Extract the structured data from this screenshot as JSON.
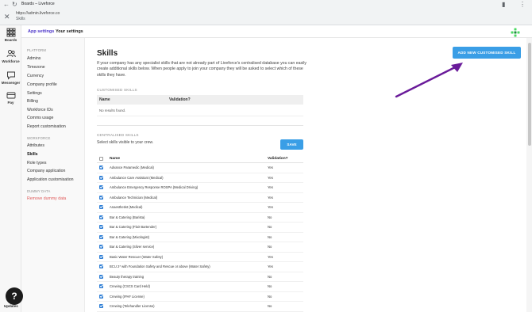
{
  "browser": {
    "tab_title": "Boards – Liveforce",
    "url": "https://admin.liveforce.co",
    "page_label": "Skills",
    "icons": [
      "back-icon",
      "reload-icon",
      "close-icon",
      "puzzle-icon",
      "menu-icon"
    ]
  },
  "left_nav": {
    "items": [
      {
        "label": "Boards",
        "icon": "grid-icon"
      },
      {
        "label": "Workforce",
        "icon": "people-icon"
      },
      {
        "label": "Messenger",
        "icon": "chat-icon"
      },
      {
        "label": "Pay",
        "icon": "pay-icon"
      }
    ]
  },
  "app_header": {
    "tabs": [
      "App settings",
      "Your settings"
    ],
    "accent": "#4c35c9",
    "logo_color": "#4cd964"
  },
  "sidebar": {
    "platform_heading": "PLATFORM",
    "platform_items": [
      "Admins",
      "Timezone",
      "Currency",
      "Company profile",
      "Settings",
      "Billing",
      "Workforce IDs",
      "Comms usage",
      "Report customisation"
    ],
    "workforce_heading": "WORKFORCE",
    "workforce_items": [
      "Attributes",
      "Skills",
      "Role types",
      "Company application",
      "Application customisation"
    ],
    "active_item": "Skills",
    "dummy_heading": "DUMMY DATA",
    "dummy_item": "Remove dummy data"
  },
  "main": {
    "title": "Skills",
    "intro": "If your company has any specialist skills that are not already part of Liveforce's centralised database you can easily create additional skills below. When people apply to join your company they will be asked to select which of these skills they have.",
    "add_button": "ADD NEW CUSTOMISED SKILL",
    "customised_label": "CUSTOMISED SKILLS",
    "customised_columns": [
      "Name",
      "Validation?"
    ],
    "customised_empty": "No results found.",
    "centralised_label": "CENTRALISED SKILLS",
    "select_help": "Select skills visible to your crew.",
    "save_button": "SAVE",
    "skill_columns": [
      "Name",
      "Validation?"
    ],
    "skills": [
      {
        "name": "Advance Paramedic (Medical)",
        "validation": "Yes"
      },
      {
        "name": "Ambulance Care Assistant (Medical)",
        "validation": "Yes"
      },
      {
        "name": "Ambulance Emergency Response ROSPA (Medical Driving)",
        "validation": "Yes"
      },
      {
        "name": "Ambulance Technician (Medical)",
        "validation": "Yes"
      },
      {
        "name": "Anaesthetist (Medical)",
        "validation": "Yes"
      },
      {
        "name": "Bar & Catering (Barista)",
        "validation": "No"
      },
      {
        "name": "Bar & Catering (Flair Bartender)",
        "validation": "No"
      },
      {
        "name": "Bar & Catering (Mixologist)",
        "validation": "No"
      },
      {
        "name": "Bar & Catering (Silver service)",
        "validation": "No"
      },
      {
        "name": "Basic Water Rescuer (Water Safety)",
        "validation": "Yes"
      },
      {
        "name": "BCU 2* with Foundation Safety and Rescue or above (Water Safety)",
        "validation": "Yes"
      },
      {
        "name": "Beauty therapy training",
        "validation": "No"
      },
      {
        "name": "Crewing (CSCS Card Held)",
        "validation": "No"
      },
      {
        "name": "Crewing (IPAF License)",
        "validation": "No"
      },
      {
        "name": "Crewing (Telehandler License)",
        "validation": "No"
      }
    ]
  },
  "help": {
    "symbol": "?",
    "label": "Updates"
  },
  "colors": {
    "primary_button": "#3a9ee6",
    "checkbox": "#2f7fd6",
    "annotation_arrow": "#6a1b9a",
    "danger": "#e05a5a"
  }
}
